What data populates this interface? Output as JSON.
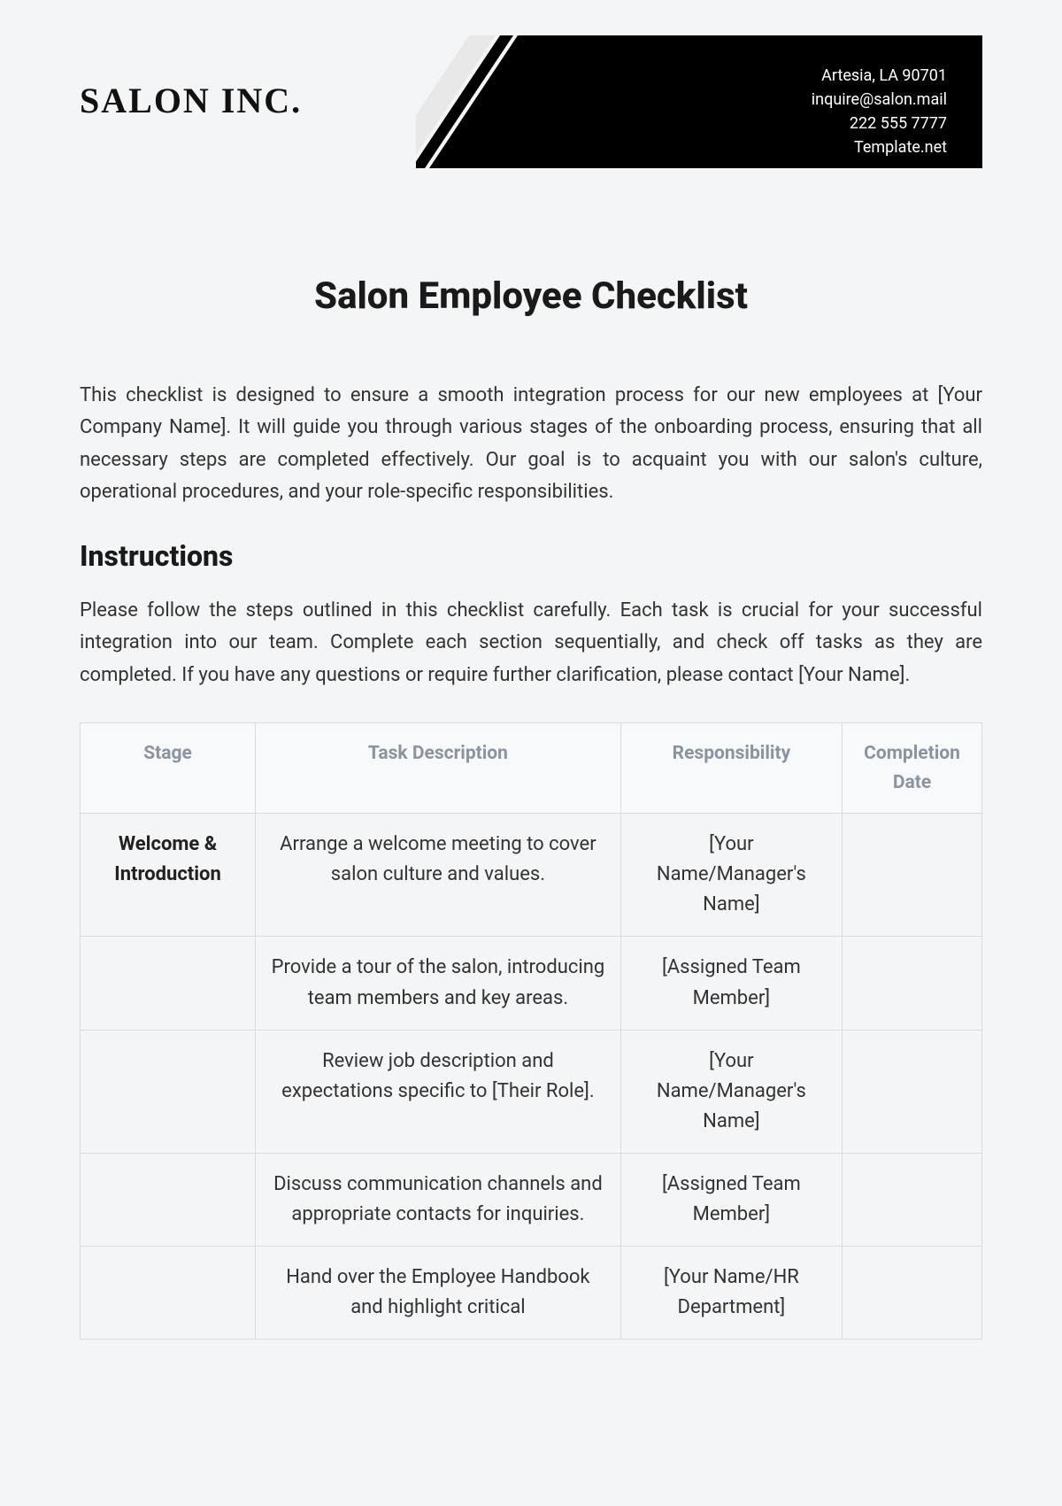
{
  "header": {
    "company_name": "SALON INC.",
    "contact": {
      "address": "Artesia, LA 90701",
      "email": "inquire@salon.mail",
      "phone": "222 555 7777",
      "website": "Template.net"
    }
  },
  "document": {
    "title": "Salon Employee Checklist",
    "intro": "This checklist is designed to ensure a smooth integration process for our new employees at [Your Company Name]. It will guide you through various stages of the onboarding process, ensuring that all necessary steps are completed effectively. Our goal is to acquaint you with our salon's culture, operational procedures, and your role-specific responsibilities.",
    "instructions_heading": "Instructions",
    "instructions_body": "Please follow the steps outlined in this checklist carefully. Each task is crucial for your successful integration into our team. Complete each section sequentially, and check off tasks as they are completed. If you have any questions or require further clarification, please contact [Your Name]."
  },
  "table": {
    "headers": {
      "stage": "Stage",
      "task": "Task Description",
      "responsibility": "Responsibility",
      "completion": "Completion Date"
    },
    "rows": [
      {
        "stage": "Welcome & Introduction",
        "task": "Arrange a welcome meeting to cover salon culture and values.",
        "responsibility": "[Your Name/Manager's Name]",
        "completion": ""
      },
      {
        "stage": "",
        "task": "Provide a tour of the salon, introducing team members and key areas.",
        "responsibility": "[Assigned Team Member]",
        "completion": ""
      },
      {
        "stage": "",
        "task": "Review job description and expectations specific to [Their Role].",
        "responsibility": "[Your Name/Manager's Name]",
        "completion": ""
      },
      {
        "stage": "",
        "task": "Discuss communication channels and appropriate contacts for inquiries.",
        "responsibility": "[Assigned Team Member]",
        "completion": ""
      },
      {
        "stage": "",
        "task": "Hand over the Employee Handbook and highlight critical",
        "responsibility": "[Your Name/HR Department]",
        "completion": ""
      }
    ]
  }
}
